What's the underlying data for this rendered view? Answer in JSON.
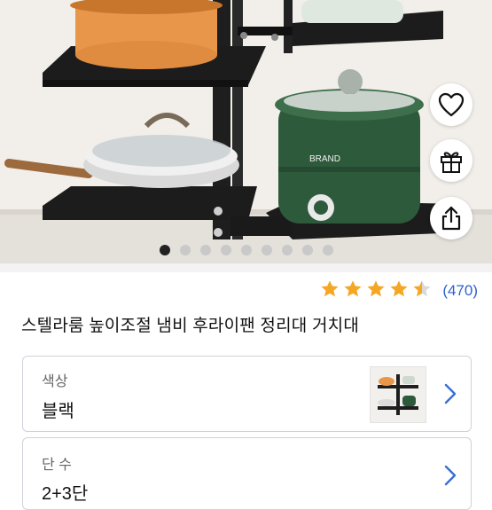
{
  "product": {
    "title": "스텔라룸 높이조절 냄비 후라이팬 정리대 거치대",
    "image_brand_text": "BRAND",
    "image_count": 9,
    "active_image_index": 0
  },
  "rating": {
    "stars": 4.5,
    "count_text": "(470)",
    "star_color": "#f5a623"
  },
  "side_actions": [
    {
      "icon": "heart-icon"
    },
    {
      "icon": "gift-icon"
    },
    {
      "icon": "share-icon"
    }
  ],
  "options": [
    {
      "label": "색상",
      "value": "블랙",
      "has_thumbnail": true
    },
    {
      "label": "단 수",
      "value": "2+3단",
      "has_thumbnail": false
    }
  ],
  "colors": {
    "link_blue": "#2f62c8",
    "chevron_blue": "#3b6fd1",
    "rack_black": "#1e1e1e",
    "pot_orange": "#e8974a",
    "cooker_green": "#2e5a3c"
  }
}
